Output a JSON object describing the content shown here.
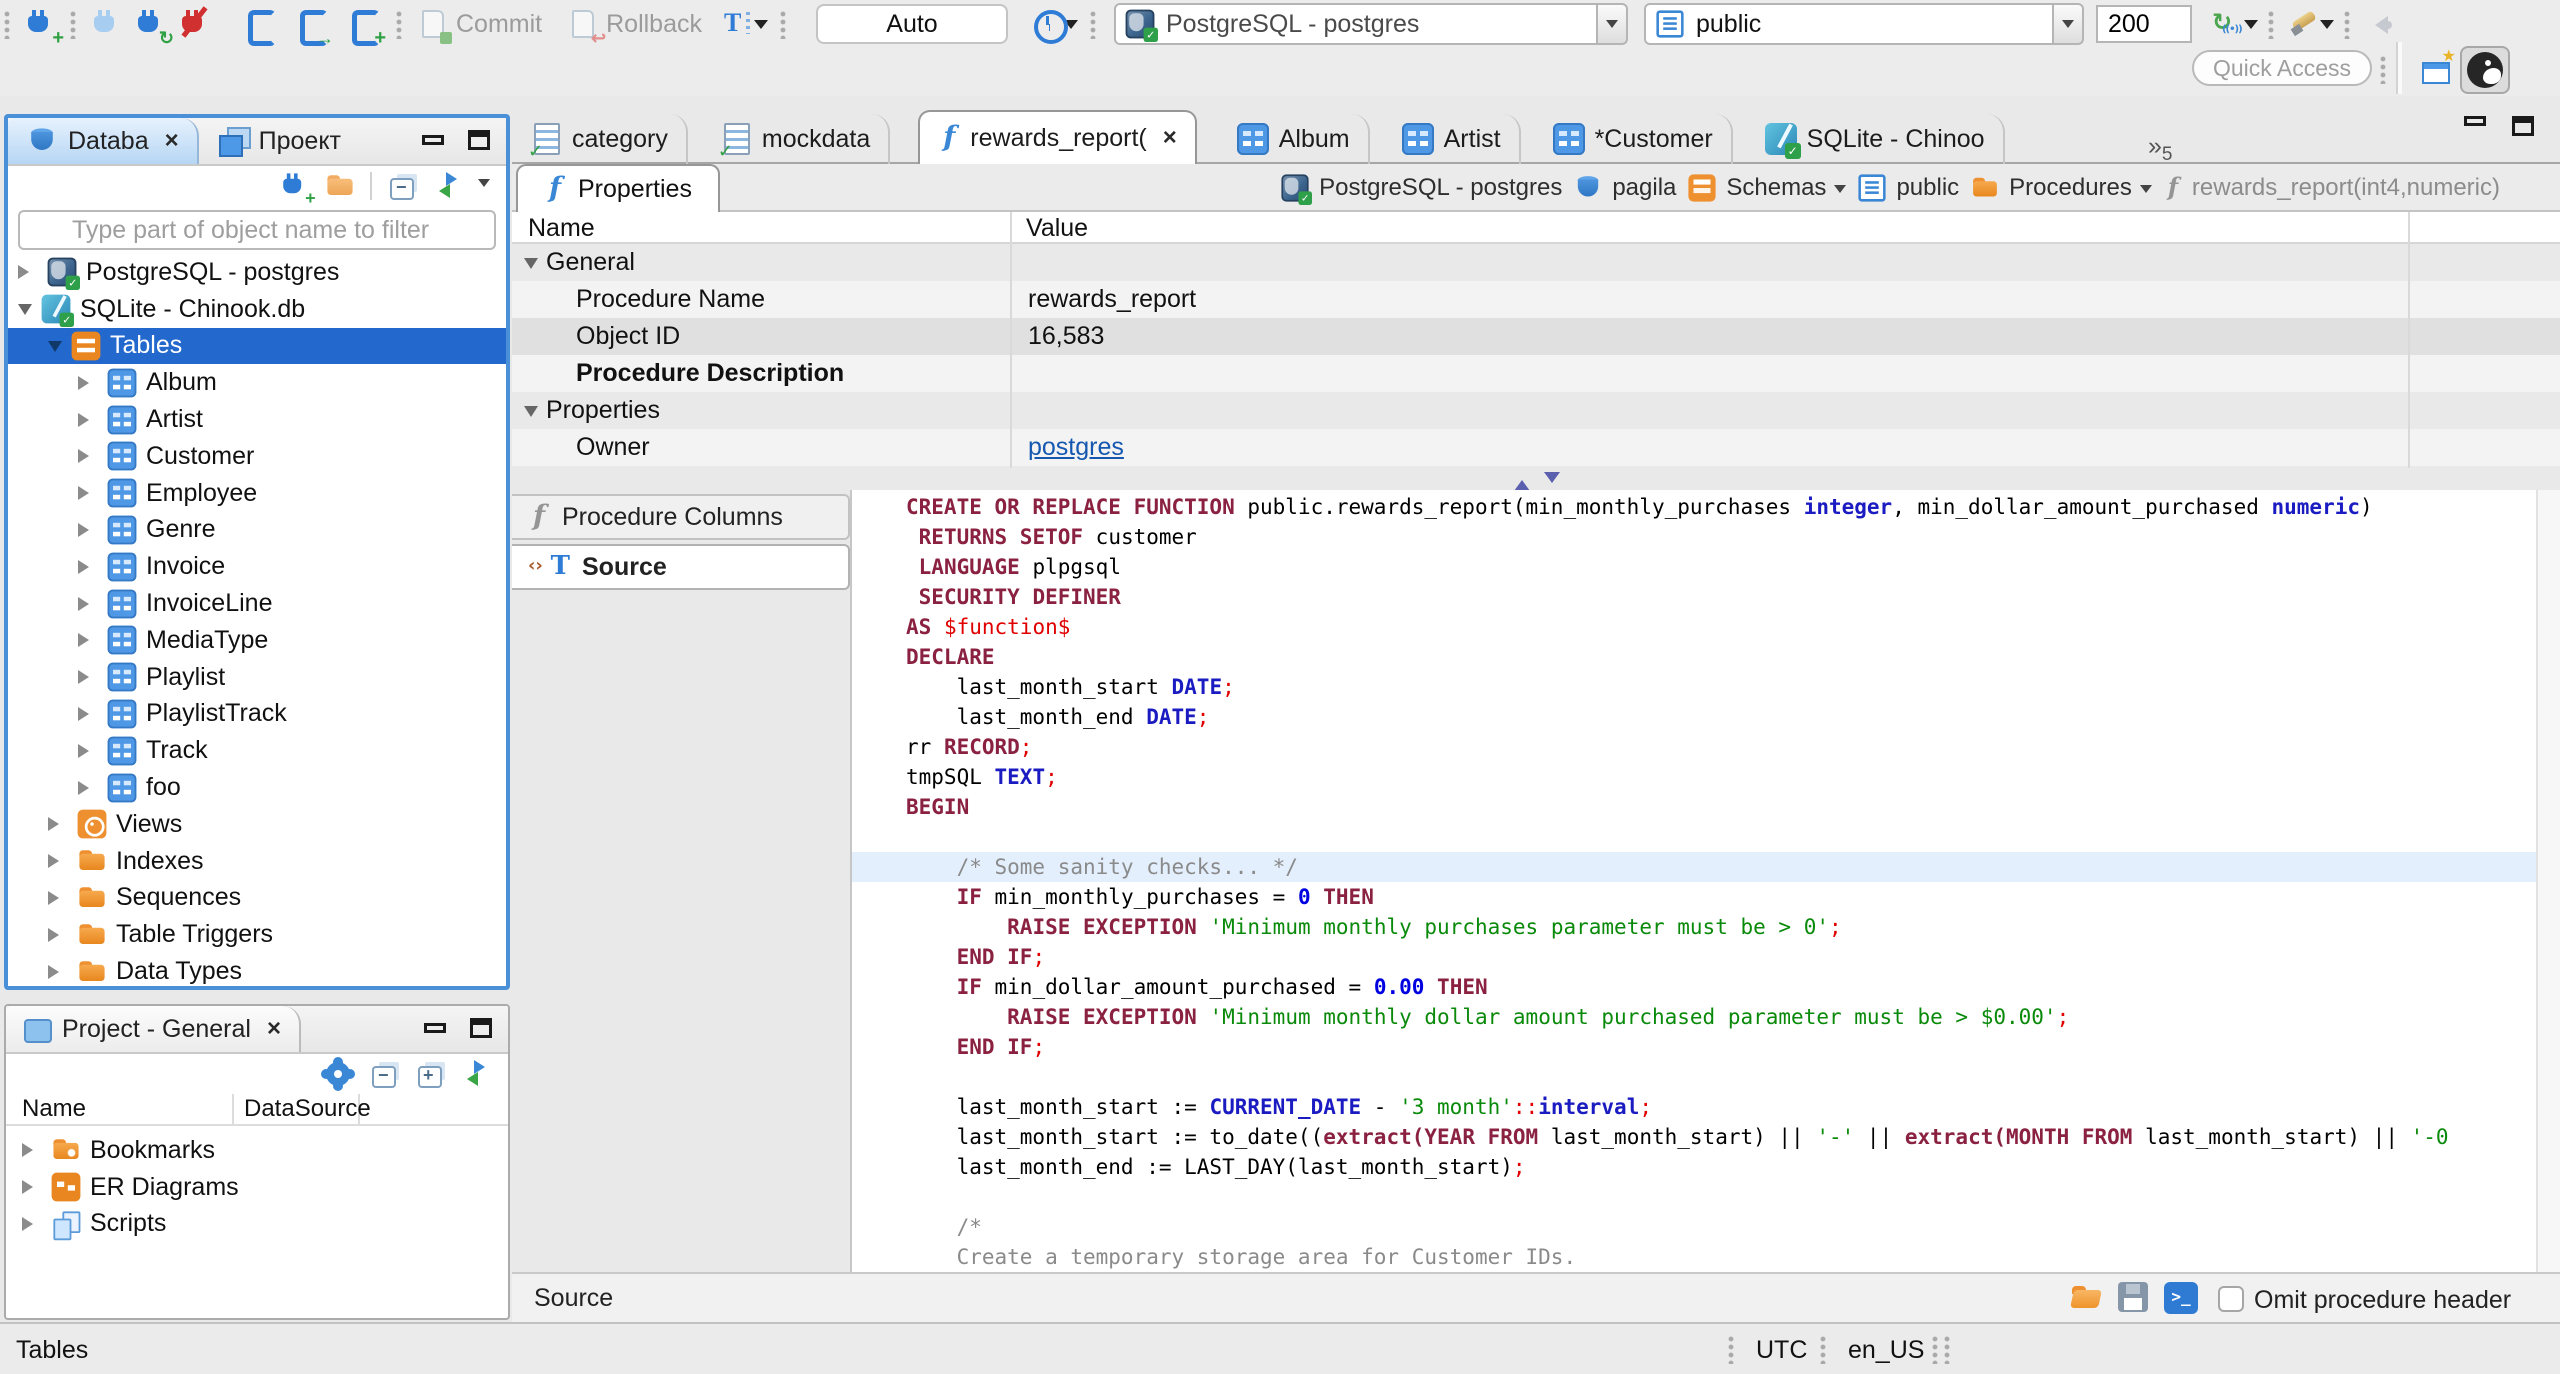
{
  "toolbar": {
    "commit": "Commit",
    "rollback": "Rollback",
    "auto": "Auto",
    "connection": "PostgreSQL - postgres",
    "schema": "public",
    "fetch_size": "200",
    "quick_access": "Quick Access"
  },
  "nav": {
    "tab_database": "Databa",
    "tab_project": "Проект",
    "filter_placeholder": "Type part of object name to filter",
    "tree": [
      {
        "label": "PostgreSQL - postgres",
        "icon": "postgres-db",
        "level": 0,
        "state": "collapsed"
      },
      {
        "label": "SQLite - Chinook.db",
        "icon": "sqlite-db",
        "level": 0,
        "state": "expanded"
      },
      {
        "label": "Tables",
        "icon": "tables-folder",
        "level": 1,
        "state": "expanded",
        "selected": true
      },
      {
        "label": "Album",
        "icon": "table",
        "level": 2,
        "state": "collapsed"
      },
      {
        "label": "Artist",
        "icon": "table",
        "level": 2,
        "state": "collapsed"
      },
      {
        "label": "Customer",
        "icon": "table",
        "level": 2,
        "state": "collapsed"
      },
      {
        "label": "Employee",
        "icon": "table",
        "level": 2,
        "state": "collapsed"
      },
      {
        "label": "Genre",
        "icon": "table",
        "level": 2,
        "state": "collapsed"
      },
      {
        "label": "Invoice",
        "icon": "table",
        "level": 2,
        "state": "collapsed"
      },
      {
        "label": "InvoiceLine",
        "icon": "table",
        "level": 2,
        "state": "collapsed"
      },
      {
        "label": "MediaType",
        "icon": "table",
        "level": 2,
        "state": "collapsed"
      },
      {
        "label": "Playlist",
        "icon": "table",
        "level": 2,
        "state": "collapsed"
      },
      {
        "label": "PlaylistTrack",
        "icon": "table",
        "level": 2,
        "state": "collapsed"
      },
      {
        "label": "Track",
        "icon": "table",
        "level": 2,
        "state": "collapsed"
      },
      {
        "label": "foo",
        "icon": "table",
        "level": 2,
        "state": "collapsed"
      },
      {
        "label": "Views",
        "icon": "views",
        "level": 1,
        "state": "collapsed"
      },
      {
        "label": "Indexes",
        "icon": "folder",
        "level": 1,
        "state": "collapsed"
      },
      {
        "label": "Sequences",
        "icon": "folder",
        "level": 1,
        "state": "collapsed"
      },
      {
        "label": "Table Triggers",
        "icon": "folder",
        "level": 1,
        "state": "collapsed"
      },
      {
        "label": "Data Types",
        "icon": "folder",
        "level": 1,
        "state": "collapsed"
      }
    ]
  },
  "project": {
    "title": "Project - General",
    "col_name": "Name",
    "col_datasource": "DataSource",
    "rows": [
      {
        "label": "Bookmarks",
        "icon": "folder-star"
      },
      {
        "label": "ER Diagrams",
        "icon": "er"
      },
      {
        "label": "Scripts",
        "icon": "scripts"
      }
    ]
  },
  "editor": {
    "tabs": [
      {
        "label": "category",
        "icon": "sql-script"
      },
      {
        "label": "mockdata",
        "icon": "sql-script"
      },
      {
        "label": "rewards_report(",
        "icon": "function",
        "active": true,
        "closable": true
      },
      {
        "label": "Album",
        "icon": "table"
      },
      {
        "label": "Artist",
        "icon": "table"
      },
      {
        "label": "*Customer",
        "icon": "table"
      },
      {
        "label": "SQLite - Chinoo",
        "icon": "sqlite-db"
      }
    ],
    "overflow_count": "5",
    "properties_tab": "Properties",
    "breadcrumb": [
      {
        "label": "PostgreSQL - postgres",
        "icon": "postgres-db"
      },
      {
        "label": "pagila",
        "icon": "database"
      },
      {
        "label": "Schemas",
        "icon": "schemas",
        "dropdown": true
      },
      {
        "label": "public",
        "icon": "page"
      },
      {
        "label": "Procedures",
        "icon": "folder",
        "dropdown": true
      },
      {
        "label": "rewards_report(int4,numeric)",
        "icon": "function-muted",
        "muted": true
      }
    ],
    "grid": {
      "col_name": "Name",
      "col_value": "Value",
      "rows": [
        {
          "name": "General",
          "group": true,
          "value": ""
        },
        {
          "name": "Procedure Name",
          "value": "rewards_report"
        },
        {
          "name": "Object ID",
          "value": "16,583",
          "selected": true
        },
        {
          "name": "Procedure Description",
          "bold": true,
          "value": ""
        },
        {
          "name": "Properties",
          "group": true,
          "value": ""
        },
        {
          "name": "Owner",
          "value": "postgres",
          "link": true
        }
      ]
    },
    "subtabs": [
      {
        "label": "Procedure Columns",
        "icon": "function-muted"
      },
      {
        "label": "Source",
        "icon": "source",
        "active": true
      }
    ],
    "footer_label": "Source",
    "omit_checkbox_label": "Omit procedure header"
  },
  "source_code": {
    "lines": [
      {
        "seg": [
          [
            "kw",
            "CREATE OR REPLACE FUNCTION"
          ],
          [
            "pl",
            " public.rewards_report(min_monthly_purchases "
          ],
          [
            "ty",
            "integer"
          ],
          [
            "pl",
            ", min_dollar_amount_purchased "
          ],
          [
            "ty",
            "numeric"
          ],
          [
            "pl",
            ")"
          ]
        ]
      },
      {
        "seg": [
          [
            "pl",
            " "
          ],
          [
            "kw",
            "RETURNS SETOF"
          ],
          [
            "pl",
            " customer"
          ]
        ]
      },
      {
        "seg": [
          [
            "pl",
            " "
          ],
          [
            "kw",
            "LANGUAGE"
          ],
          [
            "pl",
            " plpgsql"
          ]
        ]
      },
      {
        "seg": [
          [
            "pl",
            " "
          ],
          [
            "kw",
            "SECURITY DEFINER"
          ]
        ]
      },
      {
        "seg": [
          [
            "kw",
            "AS"
          ],
          [
            "pl",
            " "
          ],
          [
            "red",
            "$function$"
          ]
        ]
      },
      {
        "seg": [
          [
            "kw",
            "DECLARE"
          ]
        ]
      },
      {
        "seg": [
          [
            "pl",
            "    last_month_start "
          ],
          [
            "ty",
            "DATE"
          ],
          [
            "red",
            ";"
          ]
        ]
      },
      {
        "seg": [
          [
            "pl",
            "    last_month_end "
          ],
          [
            "ty",
            "DATE"
          ],
          [
            "red",
            ";"
          ]
        ]
      },
      {
        "seg": [
          [
            "pl",
            "rr "
          ],
          [
            "kw",
            "RECORD"
          ],
          [
            "red",
            ";"
          ]
        ]
      },
      {
        "seg": [
          [
            "pl",
            "tmpSQL "
          ],
          [
            "ty",
            "TEXT"
          ],
          [
            "red",
            ";"
          ]
        ]
      },
      {
        "seg": [
          [
            "kw",
            "BEGIN"
          ]
        ]
      },
      {
        "seg": []
      },
      {
        "hl": true,
        "seg": [
          [
            "cm",
            "    /* Some sanity checks... */"
          ]
        ]
      },
      {
        "seg": [
          [
            "pl",
            "    "
          ],
          [
            "kw",
            "IF"
          ],
          [
            "pl",
            " min_monthly_purchases = "
          ],
          [
            "num",
            "0"
          ],
          [
            "pl",
            " "
          ],
          [
            "kw",
            "THEN"
          ]
        ]
      },
      {
        "seg": [
          [
            "pl",
            "        "
          ],
          [
            "kw",
            "RAISE EXCEPTION"
          ],
          [
            "pl",
            " "
          ],
          [
            "str",
            "'Minimum monthly purchases parameter must be > 0'"
          ],
          [
            "red",
            ";"
          ]
        ]
      },
      {
        "seg": [
          [
            "pl",
            "    "
          ],
          [
            "kw",
            "END IF"
          ],
          [
            "red",
            ";"
          ]
        ]
      },
      {
        "seg": [
          [
            "pl",
            "    "
          ],
          [
            "kw",
            "IF"
          ],
          [
            "pl",
            " min_dollar_amount_purchased = "
          ],
          [
            "num",
            "0.00"
          ],
          [
            "pl",
            " "
          ],
          [
            "kw",
            "THEN"
          ]
        ]
      },
      {
        "seg": [
          [
            "pl",
            "        "
          ],
          [
            "kw",
            "RAISE EXCEPTION"
          ],
          [
            "pl",
            " "
          ],
          [
            "str",
            "'Minimum monthly dollar amount purchased parameter must be > $0.00'"
          ],
          [
            "red",
            ";"
          ]
        ]
      },
      {
        "seg": [
          [
            "pl",
            "    "
          ],
          [
            "kw",
            "END IF"
          ],
          [
            "red",
            ";"
          ]
        ]
      },
      {
        "seg": []
      },
      {
        "seg": [
          [
            "pl",
            "    last_month_start := "
          ],
          [
            "ty",
            "CURRENT_DATE"
          ],
          [
            "pl",
            " - "
          ],
          [
            "str",
            "'3 month'"
          ],
          [
            "red",
            "::"
          ],
          [
            "ty",
            "interval"
          ],
          [
            "red",
            ";"
          ]
        ]
      },
      {
        "seg": [
          [
            "pl",
            "    last_month_start := to_date(("
          ],
          [
            "kw",
            "extract("
          ],
          [
            "kw",
            "YEAR FROM"
          ],
          [
            "pl",
            " last_month_start) || "
          ],
          [
            "str",
            "'-'"
          ],
          [
            "pl",
            " || "
          ],
          [
            "kw",
            "extract("
          ],
          [
            "kw",
            "MONTH FROM"
          ],
          [
            "pl",
            " last_month_start) || "
          ],
          [
            "str",
            "'-0"
          ]
        ]
      },
      {
        "seg": [
          [
            "pl",
            "    last_month_end := LAST_DAY(last_month_start)"
          ],
          [
            "red",
            ";"
          ]
        ]
      },
      {
        "seg": []
      },
      {
        "seg": [
          [
            "cm",
            "    /*"
          ]
        ]
      },
      {
        "seg": [
          [
            "cm",
            "    Create a temporary storage area for Customer IDs."
          ]
        ]
      },
      {
        "seg": [
          [
            "cm",
            "    */"
          ]
        ]
      }
    ]
  },
  "statusbar": {
    "left": "Tables",
    "timezone": "UTC",
    "locale": "en_US"
  }
}
